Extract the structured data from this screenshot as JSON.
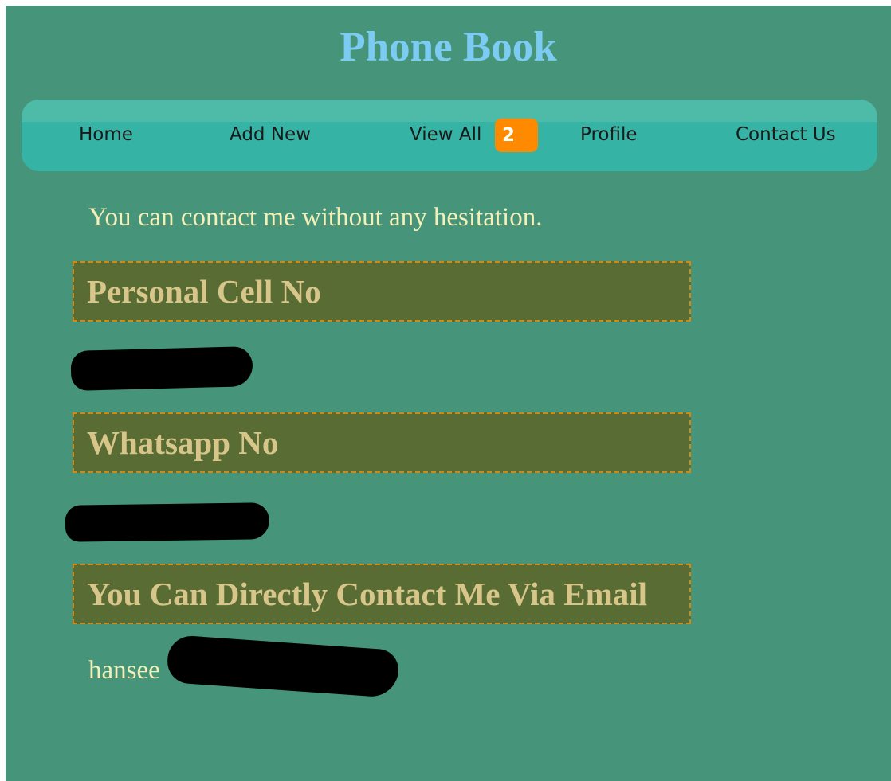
{
  "header": {
    "title": "Phone Book"
  },
  "nav": {
    "home": "Home",
    "add_new": "Add New",
    "view_all": "View All",
    "view_all_badge": "2",
    "profile": "Profile",
    "contact_us": "Contact Us"
  },
  "main": {
    "intro": "You can contact me without any hesitation.",
    "sections": [
      {
        "heading": "Personal Cell No",
        "value": ""
      },
      {
        "heading": "Whatsapp No",
        "value": ""
      },
      {
        "heading": "You Can Directly Contact Me Via Email",
        "value": "hansee"
      }
    ]
  },
  "colors": {
    "page_background": "#46957a",
    "title": "#7ccbf2",
    "nav_bar": "#35b3a5",
    "badge": "#ff8a00",
    "heading_background": "#586c33",
    "heading_text": "#d8c58a",
    "heading_border": "#d48a12",
    "body_text": "#f4f0b8"
  }
}
